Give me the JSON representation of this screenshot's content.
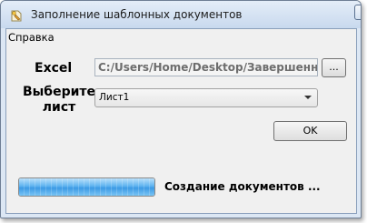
{
  "window": {
    "title": "Заполнение шаблонных документов",
    "app_icon": "document-app-icon",
    "controls": [
      "minimize-icon",
      "maximize-icon",
      "close-icon"
    ]
  },
  "menu": {
    "items": [
      {
        "label": "Справка"
      }
    ]
  },
  "form": {
    "excel_label": "Excel",
    "excel_path": "C:/Users/Home/Desktop/Завершенные",
    "browse_label": "...",
    "sheet_label_line1": "Выберите",
    "sheet_label_line2": "лист",
    "sheet_selected": "Лист1",
    "ok_label": "OK"
  },
  "progress": {
    "value": 1.0,
    "status": "Создание документов ..."
  },
  "colors": {
    "close_button": "#c74731",
    "progress_fill": "#3c9ae4",
    "window_frame": "#dce7f4"
  }
}
